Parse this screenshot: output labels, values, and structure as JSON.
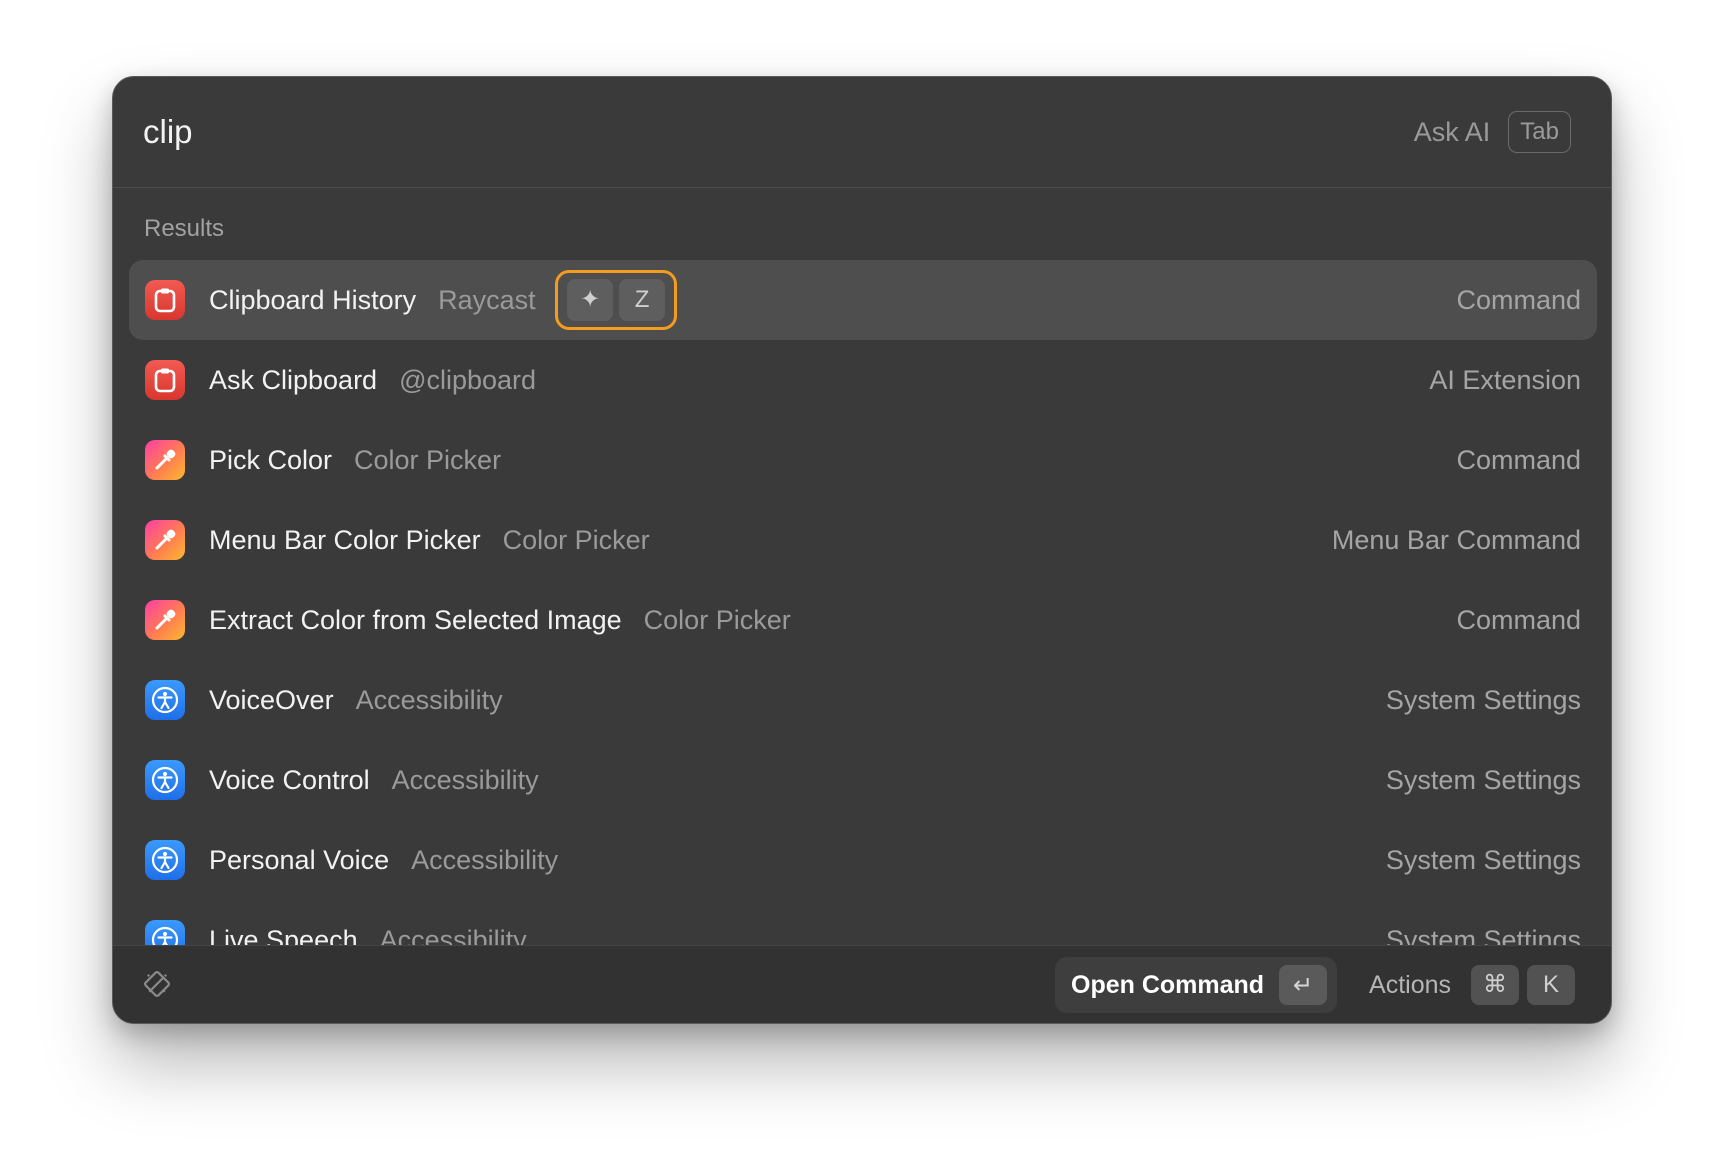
{
  "search": {
    "query": "clip",
    "ask_ai_label": "Ask AI",
    "ask_ai_key": "Tab"
  },
  "results": {
    "section_title": "Results",
    "items": [
      {
        "title": "Clipboard History",
        "subtitle": "Raycast",
        "type": "Command",
        "icon": "clipboard-icon",
        "hotkey": [
          "✦",
          "Z"
        ]
      },
      {
        "title": "Ask Clipboard",
        "subtitle": "@clipboard",
        "type": "AI Extension",
        "icon": "clipboard-icon"
      },
      {
        "title": "Pick Color",
        "subtitle": "Color Picker",
        "type": "Command",
        "icon": "eyedropper-icon"
      },
      {
        "title": "Menu Bar Color Picker",
        "subtitle": "Color Picker",
        "type": "Menu Bar Command",
        "icon": "eyedropper-icon"
      },
      {
        "title": "Extract Color from Selected Image",
        "subtitle": "Color Picker",
        "type": "Command",
        "icon": "eyedropper-icon"
      },
      {
        "title": "VoiceOver",
        "subtitle": "Accessibility",
        "type": "System Settings",
        "icon": "accessibility-icon"
      },
      {
        "title": "Voice Control",
        "subtitle": "Accessibility",
        "type": "System Settings",
        "icon": "accessibility-icon"
      },
      {
        "title": "Personal Voice",
        "subtitle": "Accessibility",
        "type": "System Settings",
        "icon": "accessibility-icon"
      },
      {
        "title": "Live Speech",
        "subtitle": "Accessibility",
        "type": "System Settings",
        "icon": "accessibility-icon"
      }
    ]
  },
  "footer": {
    "primary_action_label": "Open Command",
    "primary_action_key": "↵",
    "actions_label": "Actions",
    "actions_keys": [
      "⌘",
      "K"
    ]
  },
  "colors": {
    "window_bg": "#3a3a3a",
    "selected_row_bg": "#4e4e4e",
    "hotkey_highlight": "#f39c1f",
    "clipboard_icon": "#e2463e",
    "accessibility_icon": "#2f84f5"
  }
}
